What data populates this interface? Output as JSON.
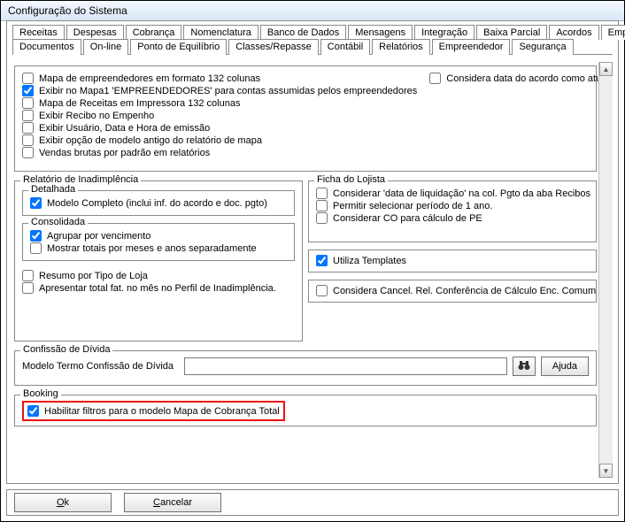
{
  "window": {
    "title": "Configuração do Sistema"
  },
  "tabs_row1": [
    {
      "label": "Receitas"
    },
    {
      "label": "Despesas"
    },
    {
      "label": "Cobrança"
    },
    {
      "label": "Nomenclatura"
    },
    {
      "label": "Banco de Dados"
    },
    {
      "label": "Mensagens"
    },
    {
      "label": "Integração"
    },
    {
      "label": "Baixa Parcial"
    },
    {
      "label": "Acordos"
    },
    {
      "label": "Empresa"
    }
  ],
  "tabs_row2": [
    {
      "label": "Documentos"
    },
    {
      "label": "On-line"
    },
    {
      "label": "Ponto de Equilíbrio"
    },
    {
      "label": "Classes/Repasse"
    },
    {
      "label": "Contábil"
    },
    {
      "label": "Relatórios",
      "active": true
    },
    {
      "label": "Empreendedor"
    },
    {
      "label": "Segurança"
    }
  ],
  "top_left": [
    {
      "label": "Mapa de empreendedores em formato 132 colunas",
      "checked": false
    },
    {
      "label": "Exibir no Mapa1 'EMPREENDEDORES' para contas assumidas pelos empreendedores",
      "checked": true
    },
    {
      "label": "Mapa de Receitas em Impressora 132 colunas",
      "checked": false
    },
    {
      "label": "Exibir Recibo no Empenho",
      "checked": false
    },
    {
      "label": "Exibir Usuário, Data e Hora de emissão",
      "checked": false
    },
    {
      "label": "Exibir opção de modelo antigo do relatório de mapa",
      "checked": false
    },
    {
      "label": "Vendas brutas por padrão em relatórios",
      "checked": false
    }
  ],
  "top_right": {
    "label": "Considera data do acordo como atual no relatório de inadimplência",
    "checked": false
  },
  "inadimplencia": {
    "title": "Relatório de Inadimplência",
    "detalhada_title": "Detalhada",
    "detalhada_item": {
      "label": "Modelo Completo (inclui inf. do acordo e doc. pgto)",
      "checked": true
    },
    "consolidada_title": "Consolidada",
    "consolidada_items": [
      {
        "label": "Agrupar por vencimento",
        "checked": true
      },
      {
        "label": "Mostrar totais por meses e anos separadamente",
        "checked": false
      }
    ],
    "extra": [
      {
        "label": "Resumo por Tipo de Loja",
        "checked": false
      },
      {
        "label": "Apresentar total fat. no mês no Perfil de Inadimplência.",
        "checked": false
      }
    ]
  },
  "ficha": {
    "title": "Ficha do Lojista",
    "items": [
      {
        "label": "Considerar 'data de liquidação' na col. Pgto da aba Recibos",
        "checked": false
      },
      {
        "label": "Permitir selecionar período de 1 ano.",
        "checked": false
      },
      {
        "label": "Considerar CO para cálculo de PE",
        "checked": false
      }
    ]
  },
  "templates": {
    "label": "Utiliza Templates",
    "checked": true
  },
  "cancel_rel": {
    "label": "Considera Cancel. Rel. Conferência de Cálculo Enc. Comum",
    "checked": false
  },
  "confissao": {
    "title": "Confissão de Dívida",
    "label": "Modelo Termo Confissão de Dívida",
    "value": "",
    "help": "Ajuda"
  },
  "booking": {
    "title": "Booking",
    "item": {
      "label": "Habilitar filtros para o modelo Mapa de Cobrança Total",
      "checked": true
    }
  },
  "footer": {
    "ok_letter": "O",
    "ok_rest": "k",
    "cancel_letter": "C",
    "cancel_rest": "ancelar"
  }
}
